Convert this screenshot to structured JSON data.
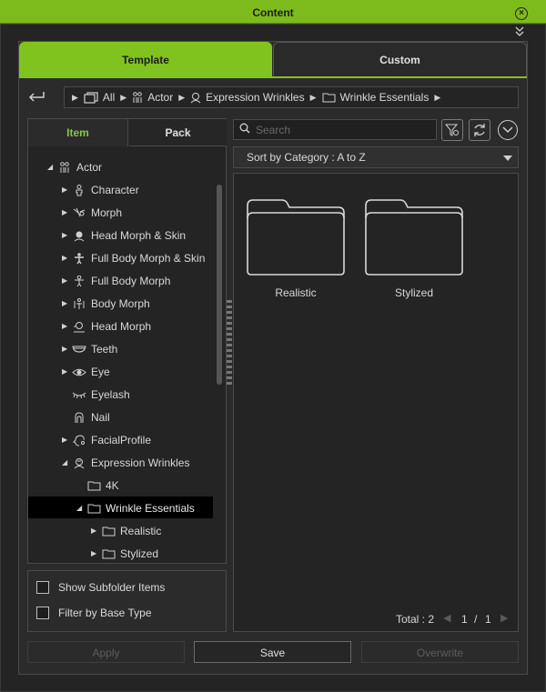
{
  "window": {
    "title": "Content"
  },
  "tabs": {
    "template": "Template",
    "custom": "Custom"
  },
  "breadcrumb": [
    {
      "label": "All"
    },
    {
      "label": "Actor"
    },
    {
      "label": "Expression Wrinkles"
    },
    {
      "label": "Wrinkle Essentials"
    }
  ],
  "subtabs": {
    "item": "Item",
    "pack": "Pack"
  },
  "tree": [
    {
      "label": "Actor",
      "icon": "actor-icon"
    },
    {
      "label": "Character",
      "icon": "character-icon"
    },
    {
      "label": "Morph",
      "icon": "morph-icon"
    },
    {
      "label": "Head Morph & Skin",
      "icon": "head-morph-skin-icon"
    },
    {
      "label": "Full Body Morph & Skin",
      "icon": "full-body-morph-skin-icon"
    },
    {
      "label": "Full Body Morph",
      "icon": "full-body-morph-icon"
    },
    {
      "label": "Body Morph",
      "icon": "body-morph-icon"
    },
    {
      "label": "Head Morph",
      "icon": "head-morph-icon"
    },
    {
      "label": "Teeth",
      "icon": "teeth-icon"
    },
    {
      "label": "Eye",
      "icon": "eye-icon"
    },
    {
      "label": "Eyelash",
      "icon": "eyelash-icon"
    },
    {
      "label": "Nail",
      "icon": "nail-icon"
    },
    {
      "label": "FacialProfile",
      "icon": "facial-profile-icon"
    },
    {
      "label": "Expression Wrinkles",
      "icon": "expression-wrinkles-icon"
    },
    {
      "label": "4K",
      "icon": "folder-icon"
    },
    {
      "label": "Wrinkle Essentials",
      "icon": "folder-icon"
    },
    {
      "label": "Realistic",
      "icon": "folder-icon"
    },
    {
      "label": "Stylized",
      "icon": "folder-icon"
    }
  ],
  "options": {
    "show_subfolder": "Show Subfolder Items",
    "filter_base": "Filter by Base Type"
  },
  "search": {
    "placeholder": "Search"
  },
  "sort": {
    "value": "Sort by Category : A to Z"
  },
  "items": [
    {
      "label": "Realistic"
    },
    {
      "label": "Stylized"
    }
  ],
  "footer": {
    "total": "Total : 2",
    "page": "1",
    "sep": "/",
    "pages": "1"
  },
  "buttons": {
    "apply": "Apply",
    "save": "Save",
    "overwrite": "Overwrite"
  }
}
